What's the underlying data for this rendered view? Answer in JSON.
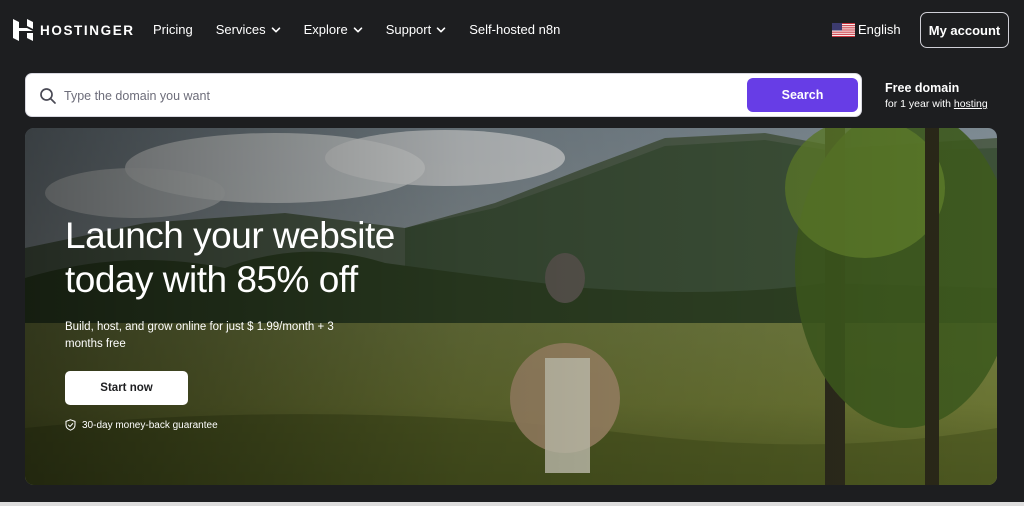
{
  "brand": {
    "name": "HOSTINGER"
  },
  "nav": {
    "links": [
      {
        "label": "Pricing",
        "dropdown": false
      },
      {
        "label": "Services",
        "dropdown": true
      },
      {
        "label": "Explore",
        "dropdown": true
      },
      {
        "label": "Support",
        "dropdown": true
      },
      {
        "label": "Self-hosted n8n",
        "dropdown": false
      }
    ],
    "language": "English",
    "account_label": "My account"
  },
  "search": {
    "placeholder": "Type the domain you want",
    "button_label": "Search"
  },
  "free_domain": {
    "title": "Free domain",
    "subtitle_prefix": "for 1 year with ",
    "link_label": "hosting"
  },
  "hero": {
    "title_line1": "Launch your website",
    "title_line2": "today with 85% off",
    "subtitle": "Build, host, and grow online for just $ 1.99/month + 3 months free",
    "cta_label": "Start now",
    "guarantee": "30-day money-back guarantee"
  },
  "colors": {
    "background": "#1d1e20",
    "accent": "#673de6",
    "text": "#ffffff"
  }
}
